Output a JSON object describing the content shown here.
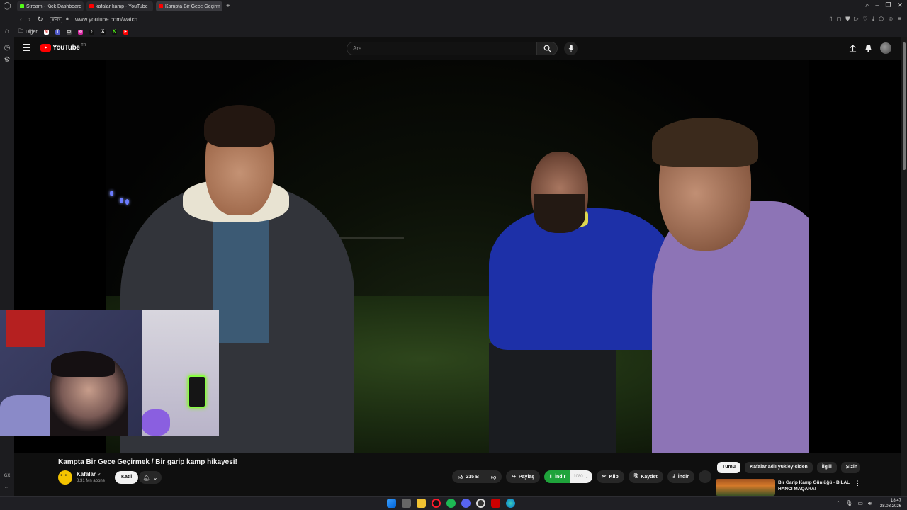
{
  "browser": {
    "tabs": [
      {
        "label": "Stream - Kick Dashboard",
        "active": false,
        "favicon_color": "#53fc18"
      },
      {
        "label": "kafalar kamp - YouTube",
        "active": false,
        "favicon_color": "#ff0000"
      },
      {
        "label": "Kampta Bir Gece Geçirmek",
        "active": true,
        "favicon_color": "#ff0000"
      }
    ],
    "new_tab": "+",
    "vpn_badge": "VPN",
    "url": "www.youtube.com/watch",
    "bookmarks_folder": "Diğer",
    "bookmark_icons": [
      "gmail-icon",
      "teams-icon",
      "twitch-icon",
      "instagram-icon",
      "tiktok-icon",
      "x-icon",
      "kick-icon",
      "youtube-icon"
    ]
  },
  "youtube": {
    "logo_text": "YouTube",
    "logo_country": "TR",
    "search_placeholder": "Ara"
  },
  "video": {
    "title": "Kampta Bir Gece Geçirmek / Bir garip kamp hikayesi!",
    "channel_name": "Kafalar",
    "subscribers": "8,31 Mn abone",
    "join_label": "Katıl",
    "likes": "215 B",
    "share_label": "Paylaş",
    "download_label": "İndir",
    "download_size": "1080",
    "clip_label": "Klip",
    "save_label": "Kaydet",
    "download2_label": "İndir"
  },
  "sidebar": {
    "chips": [
      {
        "label": "Tümü",
        "active": true
      },
      {
        "label": "Kafalar adlı yükleyiciden",
        "active": false
      },
      {
        "label": "İlgili",
        "active": false
      },
      {
        "label": "Sizin",
        "active": false
      }
    ],
    "recommendation": {
      "title": "Bir Garip Kamp Günlüğü - BİLAL HANCI MAQARA!"
    }
  },
  "taskbar": {
    "time": "18:47",
    "date": "28.03.2026"
  },
  "rail": {
    "label_bottom": "GX"
  },
  "colors": {
    "accent_red": "#ff0000",
    "download_green": "#1fa33b",
    "background": "#0f0f0f"
  }
}
